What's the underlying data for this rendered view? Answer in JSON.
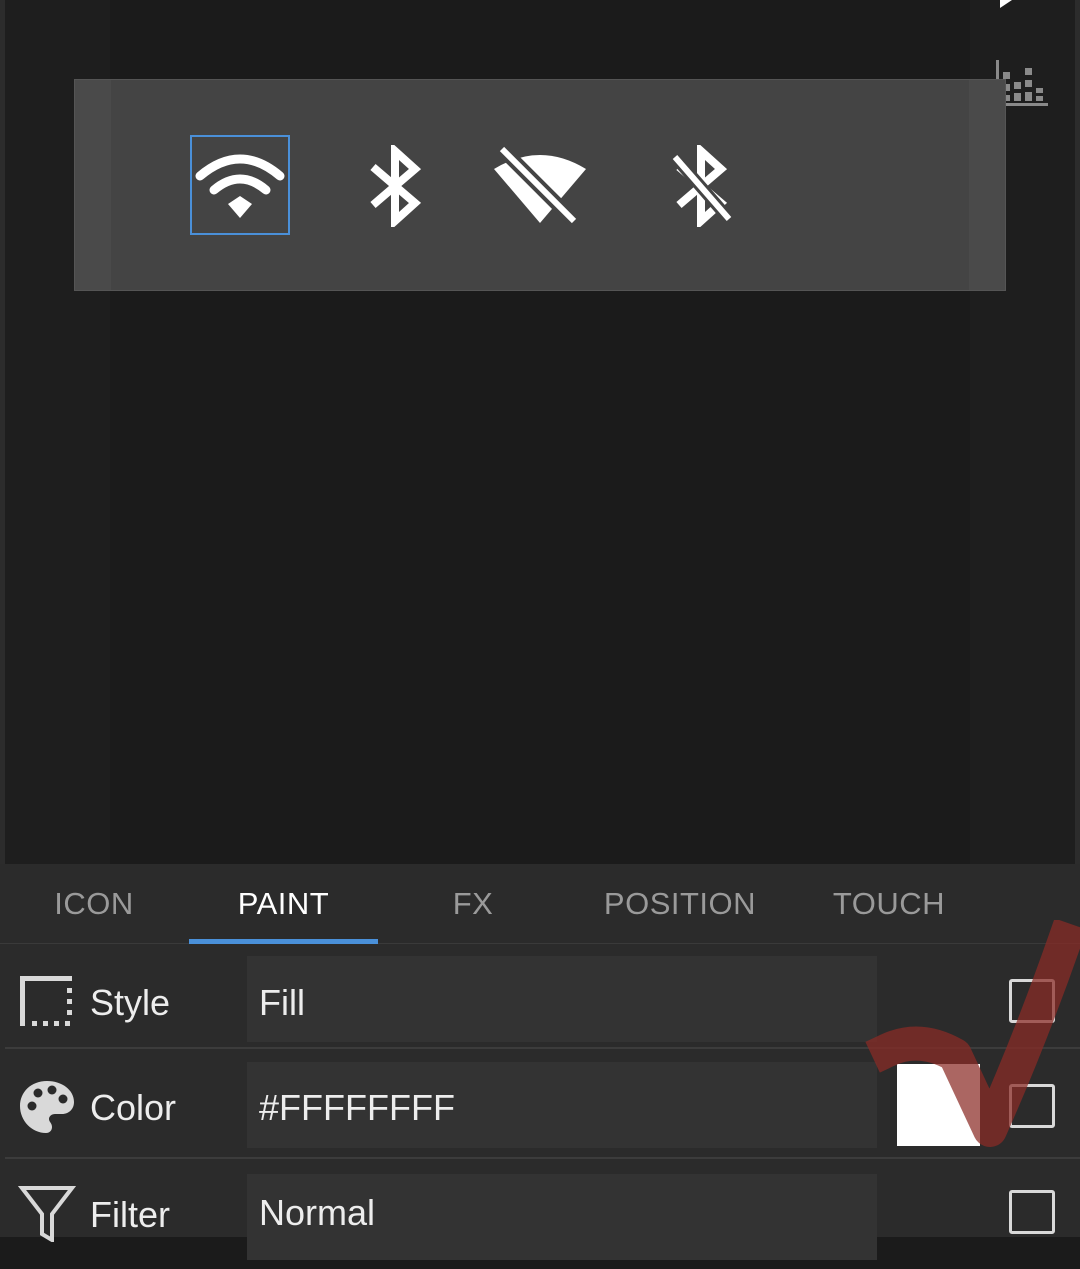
{
  "preview": {
    "widget_icons": [
      {
        "name": "wifi-icon",
        "selected": true
      },
      {
        "name": "bluetooth-icon",
        "selected": false
      },
      {
        "name": "wifi-off-icon",
        "selected": false
      },
      {
        "name": "bluetooth-off-icon",
        "selected": false
      }
    ]
  },
  "tabs": [
    {
      "label": "ICON",
      "active": false
    },
    {
      "label": "PAINT",
      "active": true
    },
    {
      "label": "FX",
      "active": false
    },
    {
      "label": "POSITION",
      "active": false
    },
    {
      "label": "TOUCH",
      "active": false
    }
  ],
  "properties": {
    "style": {
      "label": "Style",
      "value": "Fill",
      "icon": "style-icon"
    },
    "color": {
      "label": "Color",
      "value": "#FFFFFFFF",
      "icon": "palette-icon",
      "swatch": "#FFFFFF"
    },
    "filter": {
      "label": "Filter",
      "value": "Normal",
      "icon": "filter-icon"
    }
  },
  "colors": {
    "accent": "#4a90d9",
    "background": "#1b1b1b",
    "panel": "#2b2b2b",
    "widget": "#444444",
    "annotation_mark": "#8b2b25"
  }
}
